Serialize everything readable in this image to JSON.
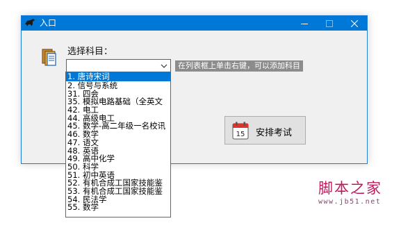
{
  "window": {
    "title": "入口",
    "controls": [
      "minimize",
      "maximize",
      "close"
    ]
  },
  "form": {
    "subject_label": "选择科目：",
    "combo_value": "",
    "hint": "在列表框上单击右键，可以添加科目",
    "schedule_button": "安排考试",
    "calendar_day": "15"
  },
  "dropdown": {
    "selected_index": 0,
    "items": [
      "1. 唐诗宋词",
      "2. 信号与系统",
      "31. 四会",
      "35. 模拟电路基础（全英文",
      "42. 电工",
      "44. 高级电工",
      "45. 数学-高二年级一名校讯",
      "46. 数学",
      "47. 语文",
      "48. 英语",
      "49. 高中化学",
      "50. 科学",
      "51. 初中英语",
      "52. 有机合成工国家技能鉴",
      "53. 有机合成工国家技能鉴",
      "54. 民法学",
      "55. 数学"
    ]
  },
  "watermark": {
    "title": "脚本之家",
    "url": "www.jb51.net"
  },
  "colors": {
    "titlebar": "#0078d7",
    "selection": "#0078d7",
    "hint_bg": "#8c8c8c",
    "watermark": "#c2185b"
  },
  "icons": [
    "app-icon",
    "minimize-icon",
    "maximize-icon",
    "close-icon",
    "book-icon",
    "chevron-down-icon",
    "calendar-icon"
  ]
}
